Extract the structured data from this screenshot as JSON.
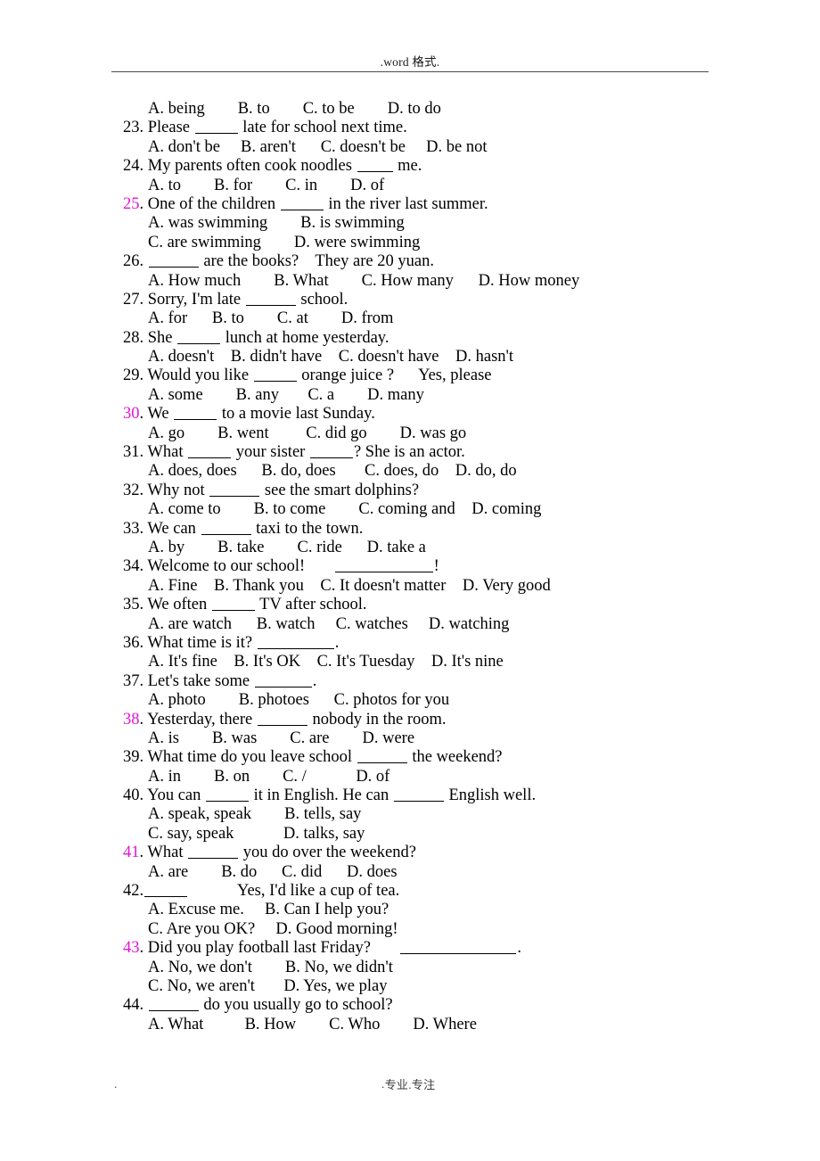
{
  "document": {
    "header_text": ".word 格式.",
    "footer": {
      "left_mark": ".",
      "center_text": "专业.专注",
      "right_mark": "."
    },
    "highlight_color": "#e316d2",
    "highlighted_numbers": [
      "25",
      "30",
      "38",
      "41",
      "43"
    ]
  },
  "lines": [
    {
      "id": "l01",
      "kind": "opt",
      "text": "A. being        B. to        C. to be        D. to do"
    },
    {
      "id": "l02",
      "kind": "q",
      "num": "23.",
      "highlight": false,
      "pre": " Please ",
      "blank": "w2",
      "post": " late for school next time."
    },
    {
      "id": "l03",
      "kind": "opt",
      "text": "A. don't be     B. aren't      C. doesn't be     D. be not"
    },
    {
      "id": "l04",
      "kind": "q",
      "num": "24.",
      "highlight": false,
      "pre": " My parents often cook noodles ",
      "blank": "w1",
      "post": " me."
    },
    {
      "id": "l05",
      "kind": "opt",
      "text": "A. to        B. for        C. in        D. of"
    },
    {
      "id": "l06",
      "kind": "q",
      "num": "25.",
      "highlight": true,
      "pre": " One of the children ",
      "blank": "w2",
      "post": " in the river last summer."
    },
    {
      "id": "l07",
      "kind": "opt",
      "text": "A. was swimming        B. is swimming"
    },
    {
      "id": "l08",
      "kind": "opt",
      "text": "C. are swimming        D. were swimming"
    },
    {
      "id": "l09",
      "kind": "q",
      "num": "26.",
      "highlight": false,
      "pre": " ",
      "blank": "w3",
      "post": " are the books?    They are 20 yuan."
    },
    {
      "id": "l10",
      "kind": "opt",
      "text": "A. How much        B. What        C. How many      D. How money"
    },
    {
      "id": "l11",
      "kind": "q",
      "num": "27.",
      "highlight": false,
      "pre": " Sorry, I'm late ",
      "blank": "w3",
      "post": " school."
    },
    {
      "id": "l12",
      "kind": "opt",
      "text": "A. for      B. to        C. at        D. from"
    },
    {
      "id": "l13",
      "kind": "q",
      "num": "28.",
      "highlight": false,
      "pre": " She ",
      "blank": "w2",
      "post": " lunch at home yesterday."
    },
    {
      "id": "l14",
      "kind": "opt",
      "text": "A. doesn't    B. didn't have    C. doesn't have    D. hasn't"
    },
    {
      "id": "l15",
      "kind": "q",
      "num": "29.",
      "highlight": false,
      "pre": " Would you like ",
      "blank": "w2",
      "post": " orange juice ?      Yes, please"
    },
    {
      "id": "l16",
      "kind": "opt",
      "text": "A. some        B. any       C. a        D. many"
    },
    {
      "id": "l17",
      "kind": "q",
      "num": "30.",
      "highlight": true,
      "pre": " We ",
      "blank": "w2",
      "post": " to a movie last Sunday."
    },
    {
      "id": "l18",
      "kind": "opt",
      "text": "A. go        B. went         C. did go        D. was go"
    },
    {
      "id": "l19",
      "kind": "q",
      "num": "31.",
      "highlight": false,
      "pre": " What ",
      "blank": "w2",
      "post": " your sister ",
      "blank2": "w2",
      "post2": "? She is an actor."
    },
    {
      "id": "l20",
      "kind": "opt",
      "text": "A. does, does      B. do, does       C. does, do    D. do, do"
    },
    {
      "id": "l21",
      "kind": "q",
      "num": "32.",
      "highlight": false,
      "pre": " Why not ",
      "blank": "w3",
      "post": " see the smart dolphins?"
    },
    {
      "id": "l22",
      "kind": "opt",
      "text": "A. come to        B. to come        C. coming and    D. coming"
    },
    {
      "id": "l23",
      "kind": "q",
      "num": "33.",
      "highlight": false,
      "pre": " We can ",
      "blank": "w3",
      "post": " taxi to the town."
    },
    {
      "id": "l24",
      "kind": "opt",
      "text": "A. by        B. take        C. ride      D. take a"
    },
    {
      "id": "l25",
      "kind": "q",
      "num": "34.",
      "highlight": false,
      "pre": " Welcome to our school!       ",
      "blank": "w6",
      "post": "!"
    },
    {
      "id": "l26",
      "kind": "opt",
      "text": "A. Fine    B. Thank you    C. It doesn't matter    D. Very good"
    },
    {
      "id": "l27",
      "kind": "q",
      "num": "35.",
      "highlight": false,
      "pre": " We often ",
      "blank": "w2",
      "post": " TV after school."
    },
    {
      "id": "l28",
      "kind": "opt",
      "text": "A. are watch      B. watch     C. watches     D. watching"
    },
    {
      "id": "l29",
      "kind": "q",
      "num": "36.",
      "highlight": false,
      "pre": " What time is it? ",
      "blank": "w5",
      "post": "."
    },
    {
      "id": "l30",
      "kind": "opt",
      "text": "A. It's fine    B. It's OK    C. It's Tuesday    D. It's nine"
    },
    {
      "id": "l31",
      "kind": "q",
      "num": "37.",
      "highlight": false,
      "pre": " Let's take some ",
      "blank": "w4",
      "post": "."
    },
    {
      "id": "l32",
      "kind": "opt",
      "text": "A. photo        B. photoes      C. photos for you"
    },
    {
      "id": "l33",
      "kind": "q",
      "num": "38.",
      "highlight": true,
      "pre": " Yesterday, there ",
      "blank": "w3",
      "post": " nobody in the room."
    },
    {
      "id": "l34",
      "kind": "opt",
      "text": "A. is        B. was        C. are        D. were"
    },
    {
      "id": "l35",
      "kind": "q",
      "num": "39.",
      "highlight": false,
      "pre": " What time do you leave school ",
      "blank": "w3",
      "post": " the weekend?"
    },
    {
      "id": "l36",
      "kind": "opt",
      "text": "A. in        B. on        C. /            D. of"
    },
    {
      "id": "l37",
      "kind": "q",
      "num": "40.",
      "highlight": false,
      "pre": " You can ",
      "blank": "w2",
      "post": " it in English. He can ",
      "blank2": "w3",
      "post2": " English well."
    },
    {
      "id": "l38",
      "kind": "opt",
      "text": "A. speak, speak        B. tells, say"
    },
    {
      "id": "l39",
      "kind": "opt",
      "text": "C. say, speak            D. talks, say"
    },
    {
      "id": "l40",
      "kind": "q",
      "num": "41.",
      "highlight": true,
      "pre": " What ",
      "blank": "w3",
      "post": " you do over the weekend?"
    },
    {
      "id": "l41",
      "kind": "opt",
      "text": "A. are        B. do      C. did      D. does"
    },
    {
      "id": "l42",
      "kind": "q",
      "num": "42.",
      "highlight": false,
      "pre": "",
      "blank": "w2",
      "post": "            Yes, I'd like a cup of tea."
    },
    {
      "id": "l43",
      "kind": "opt",
      "text": "A. Excuse me.     B. Can I help you?"
    },
    {
      "id": "l44",
      "kind": "opt",
      "text": "C. Are you OK?     D. Good morning!"
    },
    {
      "id": "l45",
      "kind": "q",
      "num": "43.",
      "highlight": true,
      "pre": " Did you play football last Friday?       ",
      "blank": "w7",
      "post": "."
    },
    {
      "id": "l46",
      "kind": "opt",
      "text": "A. No, we don't        B. No, we didn't"
    },
    {
      "id": "l47",
      "kind": "opt",
      "text": "C. No, we aren't       D. Yes, we play"
    },
    {
      "id": "l48",
      "kind": "q",
      "num": "44.",
      "highlight": false,
      "pre": " ",
      "blank": "w3",
      "post": " do you usually go to school?"
    },
    {
      "id": "l49",
      "kind": "opt",
      "text": "A. What          B. How        C. Who        D. Where"
    }
  ]
}
